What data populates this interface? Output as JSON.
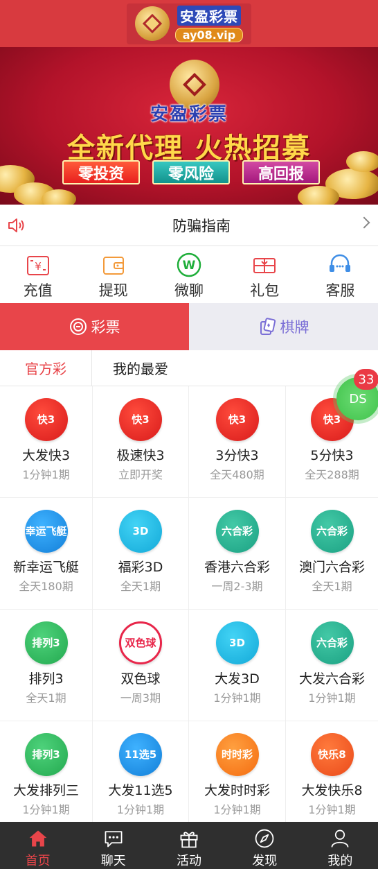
{
  "header": {
    "logo_name": "安盈彩票",
    "logo_url": "ay08.vip"
  },
  "banner": {
    "brand": "安盈彩票",
    "slogan": "全新代理 火热招募",
    "tags": [
      "零投资",
      "零风险",
      "高回报"
    ]
  },
  "notice": {
    "text": "防骗指南"
  },
  "quick_actions": [
    {
      "label": "充值",
      "icon": "recharge-icon"
    },
    {
      "label": "提现",
      "icon": "wallet-icon"
    },
    {
      "label": "微聊",
      "icon": "chat-w-icon"
    },
    {
      "label": "礼包",
      "icon": "gift-envelope-icon"
    },
    {
      "label": "客服",
      "icon": "headset-icon"
    }
  ],
  "main_tabs": [
    {
      "label": "彩票",
      "active": true
    },
    {
      "label": "棋牌",
      "active": false
    }
  ],
  "sub_tabs": [
    {
      "label": "官方彩",
      "active": true
    },
    {
      "label": "我的最爱",
      "active": false
    }
  ],
  "floating": {
    "label": "DS",
    "badge": "33"
  },
  "games": [
    {
      "name": "大发快3",
      "sub": "1分钟1期",
      "icon_text": "快3",
      "color": "red"
    },
    {
      "name": "极速快3",
      "sub": "立即开奖",
      "icon_text": "快3",
      "color": "red"
    },
    {
      "name": "3分快3",
      "sub": "全天480期",
      "icon_text": "快3",
      "color": "red"
    },
    {
      "name": "5分快3",
      "sub": "全天288期",
      "icon_text": "快3",
      "color": "red"
    },
    {
      "name": "新幸运飞艇",
      "sub": "全天180期",
      "icon_text": "幸运飞艇",
      "color": "blue"
    },
    {
      "name": "福彩3D",
      "sub": "全天1期",
      "icon_text": "3D",
      "color": "cyan"
    },
    {
      "name": "香港六合彩",
      "sub": "一周2-3期",
      "icon_text": "六合彩",
      "color": "teal"
    },
    {
      "name": "澳门六合彩",
      "sub": "全天1期",
      "icon_text": "六合彩",
      "color": "teal"
    },
    {
      "name": "排列3",
      "sub": "全天1期",
      "icon_text": "排列3",
      "color": "green"
    },
    {
      "name": "双色球",
      "sub": "一周3期",
      "icon_text": "双色球",
      "color": "pink"
    },
    {
      "name": "大发3D",
      "sub": "1分钟1期",
      "icon_text": "3D",
      "color": "cyan"
    },
    {
      "name": "大发六合彩",
      "sub": "1分钟1期",
      "icon_text": "六合彩",
      "color": "teal"
    },
    {
      "name": "大发排列三",
      "sub": "1分钟1期",
      "icon_text": "排列3",
      "color": "green"
    },
    {
      "name": "大发11选5",
      "sub": "1分钟1期",
      "icon_text": "11选5",
      "color": "blue"
    },
    {
      "name": "大发时时彩",
      "sub": "1分钟1期",
      "icon_text": "时时彩",
      "color": "orange"
    },
    {
      "name": "大发快乐8",
      "sub": "1分钟1期",
      "icon_text": "快乐8",
      "color": "tangerine"
    }
  ],
  "bottom_nav": [
    {
      "label": "首页",
      "icon": "home-icon",
      "active": true
    },
    {
      "label": "聊天",
      "icon": "chat-bubble-icon",
      "active": false
    },
    {
      "label": "活动",
      "icon": "gift-box-icon",
      "active": false
    },
    {
      "label": "发现",
      "icon": "compass-icon",
      "active": false
    },
    {
      "label": "我的",
      "icon": "user-icon",
      "active": false
    }
  ]
}
